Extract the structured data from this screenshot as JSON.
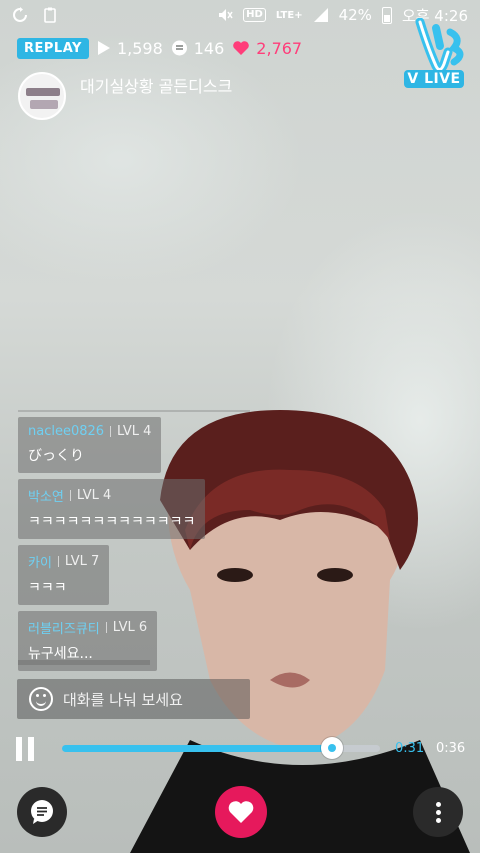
{
  "status_bar": {
    "hd_label": "HD",
    "network_label": "LTE+",
    "battery": "42%",
    "time": "오후 4:26"
  },
  "player_stats": {
    "badge": "REPLAY",
    "plays": "1,598",
    "comments": "146",
    "likes": "2,767"
  },
  "channel": {
    "name": "대기실상황 골든디스크"
  },
  "brand": {
    "logo_text": "V LIVE"
  },
  "chat": {
    "messages": [
      {
        "user": "naclee0826",
        "level": "LVL 4",
        "text": "びっくり"
      },
      {
        "user": "박소연",
        "level": "LVL 4",
        "text": "ㅋㅋㅋㅋㅋㅋㅋㅋㅋㅋㅋㅋㅋ"
      },
      {
        "user": "카이",
        "level": "LVL 7",
        "text": "ㅋㅋㅋ"
      },
      {
        "user": "러블리즈큐티",
        "level": "LVL 6",
        "text": "뉴구세요..."
      }
    ]
  },
  "comment_input": {
    "placeholder": "대화를 나눠 보세요"
  },
  "playback": {
    "current_time": "0:31",
    "total_time": "0:36",
    "progress": 0.849
  },
  "colors": {
    "accent": "#38c1ee",
    "heart": "#e6195c",
    "badge": "#2fb6e4"
  },
  "icons": {
    "status_left": [
      "refresh-icon",
      "clipboard-icon"
    ],
    "status_right": [
      "mute-icon",
      "wifi-icon",
      "signal-icon",
      "battery-icon"
    ],
    "stats": [
      "play-icon",
      "comment-icon",
      "heart-icon"
    ],
    "controls": [
      "pause-icon",
      "chat-icon",
      "heart-icon",
      "more-icon"
    ]
  }
}
